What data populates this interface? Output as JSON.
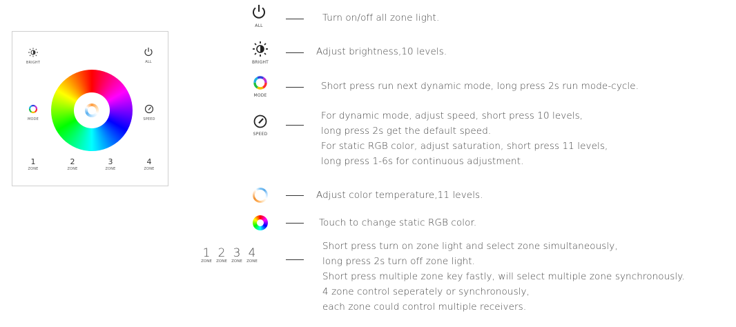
{
  "panel": {
    "bright_label": "BRIGHT",
    "all_label": "ALL",
    "mode_label": "MODE",
    "speed_label": "SPEED",
    "zones": [
      {
        "num": "1",
        "label": "ZONE"
      },
      {
        "num": "2",
        "label": "ZONE"
      },
      {
        "num": "3",
        "label": "ZONE"
      },
      {
        "num": "4",
        "label": "ZONE"
      }
    ]
  },
  "legend": {
    "all": {
      "icon": "power-icon",
      "label": "ALL",
      "lines": [
        "Turn on/off all zone light."
      ]
    },
    "bright": {
      "icon": "brightness-icon",
      "label": "BRIGHT",
      "lines": [
        "Adjust brightness,10 levels."
      ]
    },
    "mode": {
      "icon": "mode-ring-icon",
      "label": "MODE",
      "lines": [
        "Short press run next dynamic mode, long press 2s run mode-cycle."
      ]
    },
    "speed": {
      "icon": "speed-gauge-icon",
      "label": "SPEED",
      "lines": [
        "For dynamic mode, adjust speed, short press 10 levels,",
        "long press 2s get the default speed.",
        "For static RGB color, adjust saturation, short press 11 levels,",
        "long press 1-6s for continuous adjustment."
      ]
    },
    "color_temp": {
      "icon": "color-temperature-ring-icon",
      "lines": [
        "Adjust color temperature,11 levels."
      ]
    },
    "rgb_wheel": {
      "icon": "rgb-wheel-icon",
      "lines": [
        "Touch to change static RGB color."
      ]
    },
    "zones": {
      "items": [
        {
          "num": "1",
          "label": "ZONE"
        },
        {
          "num": "2",
          "label": "ZONE"
        },
        {
          "num": "3",
          "label": "ZONE"
        },
        {
          "num": "4",
          "label": "ZONE"
        }
      ],
      "lines": [
        "Short press turn on zone light and select zone simultaneously,",
        "long press 2s turn off zone light.",
        "Short press multiple zone key fastly, will select multiple zone synchronously.",
        "4 zone control seperately or synchronously,",
        "each zone could control multiple receivers."
      ]
    }
  }
}
